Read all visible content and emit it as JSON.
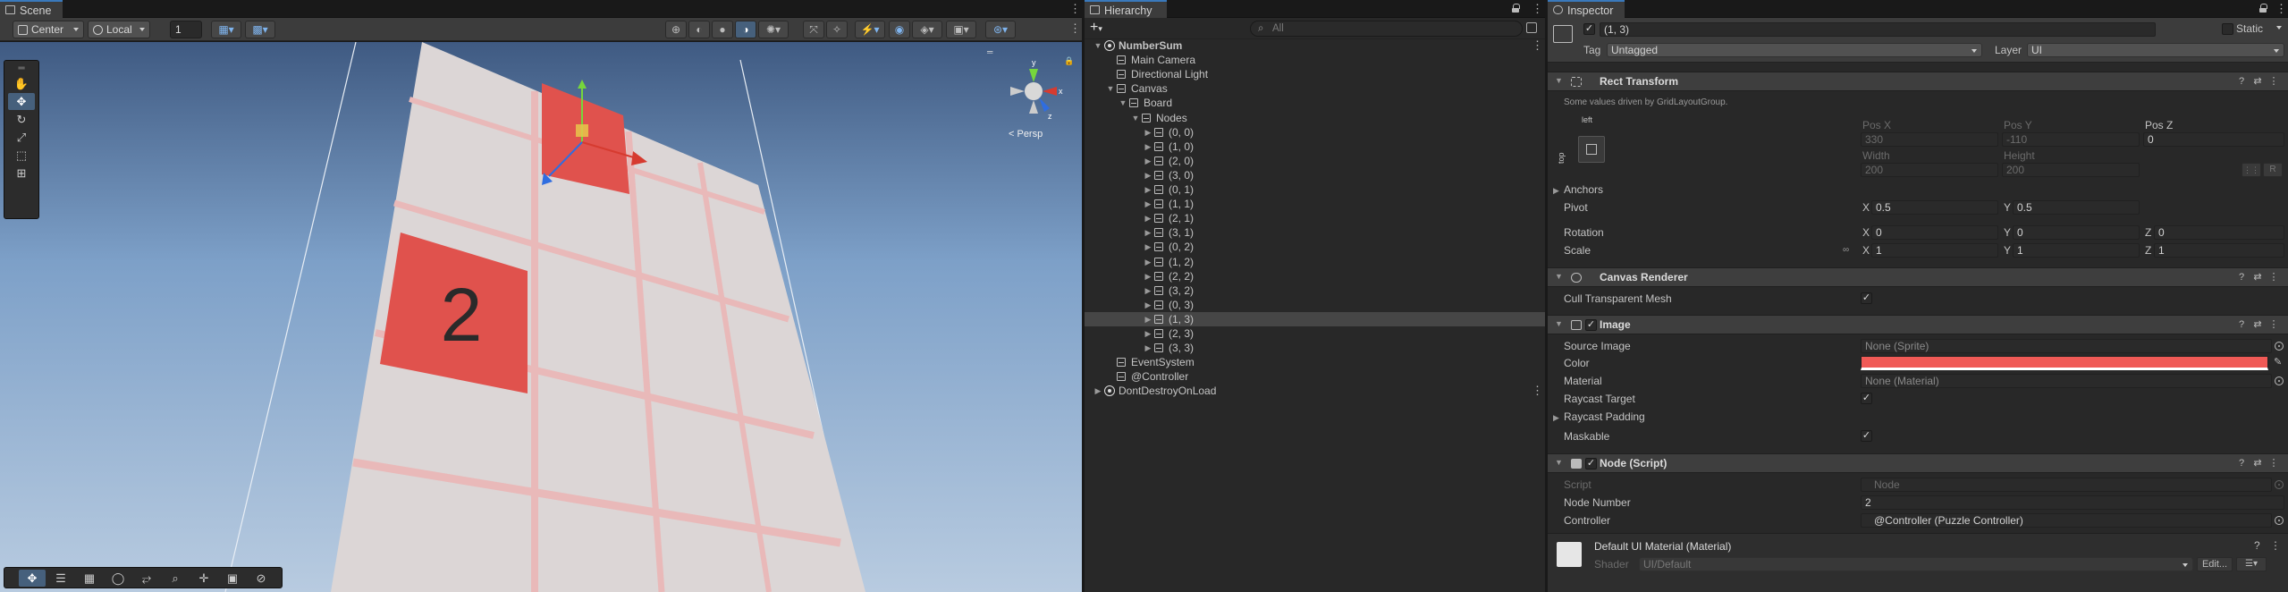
{
  "scene": {
    "tab_label": "Scene",
    "pivot_mode": "Center",
    "space_mode": "Local",
    "grid_snap_value": "1",
    "persp_label": "< Persp",
    "axis_labels": {
      "x": "x",
      "y": "y",
      "z": "z"
    },
    "tile_number": "2"
  },
  "hierarchy": {
    "tab_label": "Hierarchy",
    "add_label": "+",
    "search_placeholder": "All",
    "rows": [
      {
        "label": "NumberSum",
        "indent": 0,
        "icon": "unity-scene-icon",
        "arrow": "down",
        "bold": true
      },
      {
        "label": "Main Camera",
        "indent": 1,
        "icon": "cube-icon",
        "arrow": ""
      },
      {
        "label": "Directional Light",
        "indent": 1,
        "icon": "cube-icon",
        "arrow": ""
      },
      {
        "label": "Canvas",
        "indent": 1,
        "icon": "cube-icon",
        "arrow": "down"
      },
      {
        "label": "Board",
        "indent": 2,
        "icon": "cube-icon",
        "arrow": "down"
      },
      {
        "label": "Nodes",
        "indent": 3,
        "icon": "cube-icon",
        "arrow": "down"
      },
      {
        "label": "(0, 0)",
        "indent": 4,
        "icon": "cube-icon",
        "arrow": "right"
      },
      {
        "label": "(1, 0)",
        "indent": 4,
        "icon": "cube-icon",
        "arrow": "right"
      },
      {
        "label": "(2, 0)",
        "indent": 4,
        "icon": "cube-icon",
        "arrow": "right"
      },
      {
        "label": "(3, 0)",
        "indent": 4,
        "icon": "cube-icon",
        "arrow": "right"
      },
      {
        "label": "(0, 1)",
        "indent": 4,
        "icon": "cube-icon",
        "arrow": "right"
      },
      {
        "label": "(1, 1)",
        "indent": 4,
        "icon": "cube-icon",
        "arrow": "right"
      },
      {
        "label": "(2, 1)",
        "indent": 4,
        "icon": "cube-icon",
        "arrow": "right"
      },
      {
        "label": "(3, 1)",
        "indent": 4,
        "icon": "cube-icon",
        "arrow": "right"
      },
      {
        "label": "(0, 2)",
        "indent": 4,
        "icon": "cube-icon",
        "arrow": "right"
      },
      {
        "label": "(1, 2)",
        "indent": 4,
        "icon": "cube-icon",
        "arrow": "right"
      },
      {
        "label": "(2, 2)",
        "indent": 4,
        "icon": "cube-icon",
        "arrow": "right"
      },
      {
        "label": "(3, 2)",
        "indent": 4,
        "icon": "cube-icon",
        "arrow": "right"
      },
      {
        "label": "(0, 3)",
        "indent": 4,
        "icon": "cube-icon",
        "arrow": "right"
      },
      {
        "label": "(1, 3)",
        "indent": 4,
        "icon": "cube-icon",
        "arrow": "right",
        "selected": true
      },
      {
        "label": "(2, 3)",
        "indent": 4,
        "icon": "cube-icon",
        "arrow": "right"
      },
      {
        "label": "(3, 3)",
        "indent": 4,
        "icon": "cube-icon",
        "arrow": "right"
      },
      {
        "label": "EventSystem",
        "indent": 1,
        "icon": "cube-icon",
        "arrow": ""
      },
      {
        "label": "@Controller",
        "indent": 1,
        "icon": "cube-icon",
        "arrow": ""
      },
      {
        "label": "DontDestroyOnLoad",
        "indent": 0,
        "icon": "unity-scene-icon",
        "arrow": "right"
      }
    ]
  },
  "inspector": {
    "tab_label": "Inspector",
    "object_name": "(1, 3)",
    "static_label": "Static",
    "tag_label": "Tag",
    "tag_value": "Untagged",
    "layer_label": "Layer",
    "layer_value": "UI",
    "rect_transform": {
      "title": "Rect Transform",
      "note": "Some values driven by GridLayoutGroup.",
      "anchor_h": "left",
      "anchor_v": "top",
      "pos_x_label": "Pos X",
      "pos_x": "330",
      "pos_y_label": "Pos Y",
      "pos_y": "-110",
      "pos_z_label": "Pos Z",
      "pos_z": "0",
      "width_label": "Width",
      "width": "200",
      "height_label": "Height",
      "height": "200",
      "r_button": "R",
      "anchors_label": "Anchors",
      "pivot_label": "Pivot",
      "pivot_x": "0.5",
      "pivot_y": "0.5",
      "rotation_label": "Rotation",
      "rot_x": "0",
      "rot_y": "0",
      "rot_z": "0",
      "scale_label": "Scale",
      "scale_x": "1",
      "scale_y": "1",
      "scale_z": "1",
      "x": "X",
      "y": "Y",
      "z": "Z"
    },
    "canvas_renderer": {
      "title": "Canvas Renderer",
      "cull_label": "Cull Transparent Mesh"
    },
    "image": {
      "title": "Image",
      "source_label": "Source Image",
      "source_value": "None (Sprite)",
      "color_label": "Color",
      "color_value": "#f05a56",
      "material_label": "Material",
      "material_value": "None (Material)",
      "raycast_target_label": "Raycast Target",
      "raycast_padding_label": "Raycast Padding",
      "maskable_label": "Maskable"
    },
    "node_script": {
      "title": "Node (Script)",
      "script_label": "Script",
      "script_value": "Node",
      "node_number_label": "Node Number",
      "node_number_value": "2",
      "controller_label": "Controller",
      "controller_value": "@Controller (Puzzle Controller)"
    },
    "material": {
      "title": "Default UI Material (Material)",
      "shader_label": "Shader",
      "shader_value": "UI/Default",
      "edit_label": "Edit..."
    }
  },
  "colors": {
    "accent": "#2c5d87",
    "tile_red": "#e0524d",
    "tile_white": "#d9d4d3"
  }
}
